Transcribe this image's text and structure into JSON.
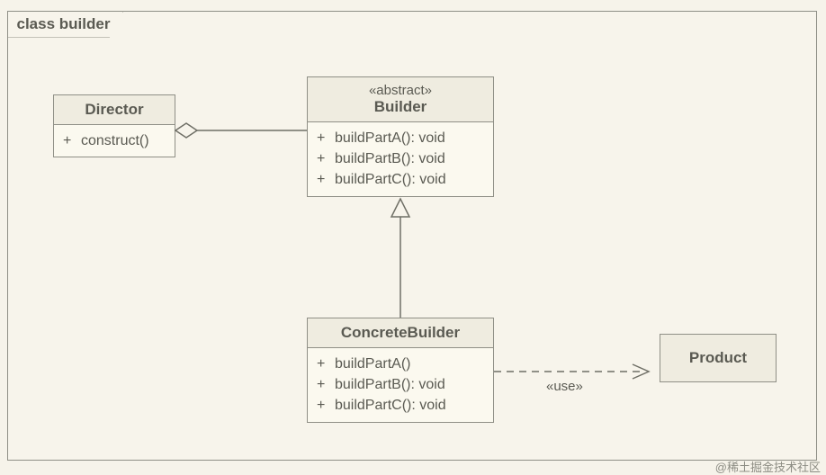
{
  "frame": {
    "title": "class builder"
  },
  "director": {
    "name": "Director",
    "ops": [
      {
        "vis": "+",
        "sig": "construct()"
      }
    ]
  },
  "builder": {
    "stereotype": "«abstract»",
    "name": "Builder",
    "ops": [
      {
        "vis": "+",
        "sig": "buildPartA(): void"
      },
      {
        "vis": "+",
        "sig": "buildPartB(): void"
      },
      {
        "vis": "+",
        "sig": "buildPartC(): void"
      }
    ]
  },
  "concrete": {
    "name": "ConcreteBuilder",
    "ops": [
      {
        "vis": "+",
        "sig": "buildPartA()"
      },
      {
        "vis": "+",
        "sig": "buildPartB(): void"
      },
      {
        "vis": "+",
        "sig": "buildPartC(): void"
      }
    ]
  },
  "product": {
    "name": "Product"
  },
  "edges": {
    "use_label": "«use»"
  },
  "watermark": "@稀土掘金技术社区"
}
